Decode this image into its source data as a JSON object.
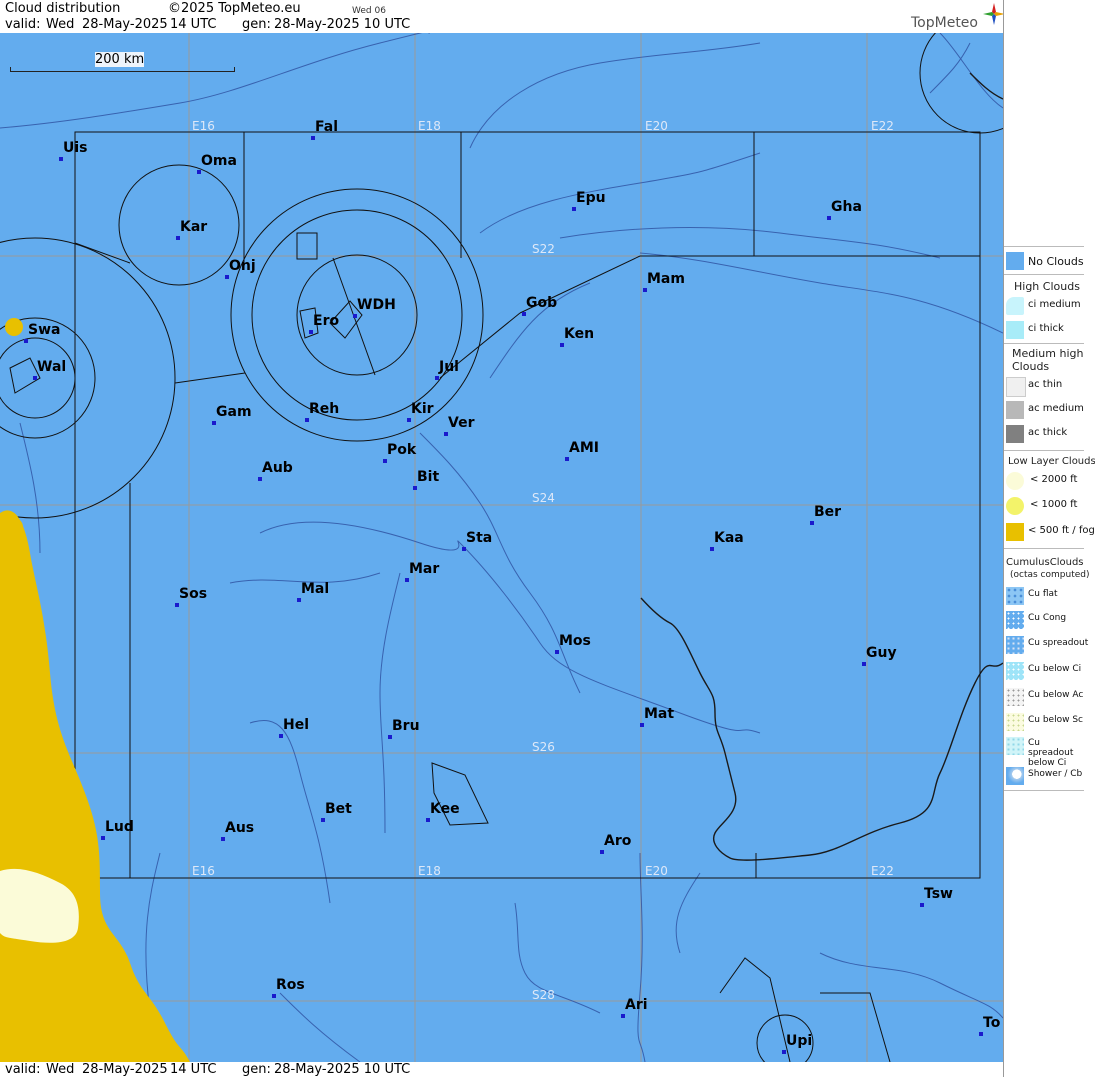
{
  "header": {
    "title": "Cloud distribution",
    "copyright": "©2025 TopMeteo.eu",
    "day_code": "Wed 06",
    "valid_label": "valid:",
    "valid_day": "Wed",
    "valid_date": "28-May-2025",
    "valid_time": "14 UTC",
    "gen_label": "gen:",
    "gen_date": "28-May-2025 10 UTC",
    "brand": "TopMeteo"
  },
  "scale": {
    "label": "200 km"
  },
  "grid": {
    "top_lon_labels": [
      "E16",
      "E18",
      "E20",
      "E22"
    ],
    "bottom_lon_labels": [
      "E16",
      "E18",
      "E20",
      "E22"
    ],
    "lat_labels": [
      "S22",
      "S24",
      "S26",
      "S28"
    ]
  },
  "cities": [
    {
      "name": "Uis"
    },
    {
      "name": "Fal"
    },
    {
      "name": "Oma"
    },
    {
      "name": "Epu"
    },
    {
      "name": "Gha"
    },
    {
      "name": "Kar"
    },
    {
      "name": "Onj"
    },
    {
      "name": "Mam"
    },
    {
      "name": "Swa"
    },
    {
      "name": "Ero"
    },
    {
      "name": "WDH"
    },
    {
      "name": "Gob"
    },
    {
      "name": "Ken"
    },
    {
      "name": "Wal"
    },
    {
      "name": "Jul"
    },
    {
      "name": "Gam"
    },
    {
      "name": "Reh"
    },
    {
      "name": "Kir"
    },
    {
      "name": "Ver"
    },
    {
      "name": "AMI"
    },
    {
      "name": "Pok"
    },
    {
      "name": "Aub"
    },
    {
      "name": "Bit"
    },
    {
      "name": "Ber"
    },
    {
      "name": "Sta"
    },
    {
      "name": "Kaa"
    },
    {
      "name": "Mar"
    },
    {
      "name": "Sos"
    },
    {
      "name": "Mal"
    },
    {
      "name": "Mos"
    },
    {
      "name": "Guy"
    },
    {
      "name": "Mat"
    },
    {
      "name": "Hel"
    },
    {
      "name": "Bru"
    },
    {
      "name": "Bet"
    },
    {
      "name": "Kee"
    },
    {
      "name": "Lud"
    },
    {
      "name": "Aus"
    },
    {
      "name": "Aro"
    },
    {
      "name": "Tsw"
    },
    {
      "name": "Ros"
    },
    {
      "name": "Ari"
    },
    {
      "name": "To"
    },
    {
      "name": "Upi"
    }
  ],
  "legend": {
    "no_clouds": "No Clouds",
    "high_title": "High Clouds",
    "ci_medium": "ci medium",
    "ci_thick": "ci thick",
    "medium_title": "Medium high Clouds",
    "ac_thin": "ac thin",
    "ac_medium": "ac medium",
    "ac_thick": "ac thick",
    "low_title": "Low Layer Clouds",
    "low_2000": "< 2000 ft",
    "low_1000": "< 1000 ft",
    "low_500": "< 500 ft / fog",
    "cu_title": "CumulusClouds",
    "cu_subtitle": "(octas computed)",
    "cu_flat": "Cu flat",
    "cu_cong": "Cu Cong",
    "cu_spreadout": "Cu spreadout",
    "cu_below_ci": "Cu below Ci",
    "cu_below_ac": "Cu below Ac",
    "cu_below_sc": "Cu below Sc",
    "cu_spreadout_below_ci": "Cu spreadout below Ci",
    "shower_cb": "Shower / Cb"
  },
  "colors": {
    "no_clouds": "#63acee",
    "fog": "#e8c000",
    "low_1000": "#f3f36a",
    "low_2000": "#fbfbd8",
    "ci": "#c8f4fc",
    "ac_thin": "#f0f0f0",
    "ac_medium": "#b8b8b8",
    "ac_thick": "#808080"
  }
}
